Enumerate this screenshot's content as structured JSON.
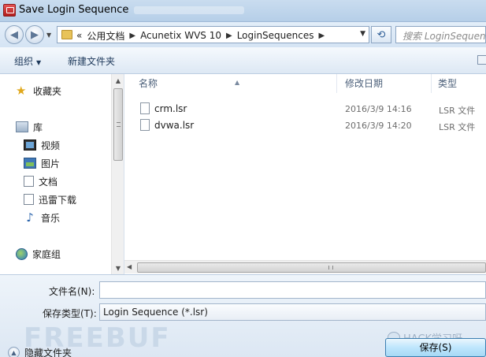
{
  "window": {
    "title": "Save Login Sequence"
  },
  "address": {
    "chevron": "«",
    "crumbs": [
      "公用文档",
      "Acunetix WVS 10",
      "LoginSequences"
    ],
    "search_placeholder": "搜索 LoginSequences"
  },
  "toolbar": {
    "organize": "组织",
    "new_folder": "新建文件夹"
  },
  "sidebar": {
    "favorites": "收藏夹",
    "libraries": "库",
    "items": [
      "视频",
      "图片",
      "文档",
      "迅雷下载",
      "音乐"
    ],
    "homegroup": "家庭组"
  },
  "filelist": {
    "columns": {
      "name": "名称",
      "date": "修改日期",
      "type": "类型"
    },
    "rows": [
      {
        "name": "crm.lsr",
        "date": "2016/3/9 14:16",
        "type": "LSR 文件"
      },
      {
        "name": "dvwa.lsr",
        "date": "2016/3/9 14:20",
        "type": "LSR 文件"
      }
    ]
  },
  "form": {
    "filename_label": "文件名(N):",
    "filename_value": "",
    "filetype_label": "保存类型(T):",
    "filetype_value": "Login Sequence (*.lsr)",
    "hide_folders": "隐藏文件夹",
    "save_button": "保存(S)"
  },
  "watermarks": {
    "logo": "FREEBUF",
    "account": "HACK学习呀"
  },
  "colors": {
    "accent": "#3c7fb1",
    "window_frame": "#c9dcef"
  }
}
